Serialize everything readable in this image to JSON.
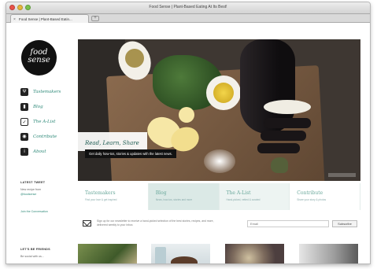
{
  "browser": {
    "window_title": "Food Sense | Plant-Based Eating At Its Best!",
    "tab_label": "Food Sense | Plant-Based Eatin..."
  },
  "site": {
    "logo_line1": "food",
    "logo_line2": "sense"
  },
  "nav": {
    "items": [
      {
        "label": "Tastemakers",
        "icon": "utensils-icon"
      },
      {
        "label": "Blog",
        "icon": "book-icon"
      },
      {
        "label": "The A-List",
        "icon": "checkbox-icon"
      },
      {
        "label": "Contribute",
        "icon": "camera-icon"
      },
      {
        "label": "About",
        "icon": "info-icon"
      }
    ]
  },
  "sidebar": {
    "tweet_heading": "LATEST TWEET",
    "tweet_text": "New recipe from",
    "tweet_handle": "@foodsense",
    "follow_label": "Join the Conversation",
    "friends_heading": "LET'S BE FRIENDS",
    "friends_text": "Be social with us..."
  },
  "hero": {
    "headline": "Read, Learn, Share",
    "subline": "Get daily how-tos, stories & updates with the latest news."
  },
  "features": [
    {
      "title": "Tastemakers",
      "desc": "Find your love & get inspired"
    },
    {
      "title": "Blog",
      "desc": "News, how-tos, stories and more"
    },
    {
      "title": "The A-List",
      "desc": "Hand-picked, vetted & curated"
    },
    {
      "title": "Contribute",
      "desc": "Share your story & photos"
    }
  ],
  "newsletter": {
    "text": "Sign up for our newsletter to receive a hand-picked selection of the best stories, recipes, and more, delivered weekly to your inbox.",
    "email_placeholder": "Email",
    "subscribe_label": "Subscribe"
  }
}
